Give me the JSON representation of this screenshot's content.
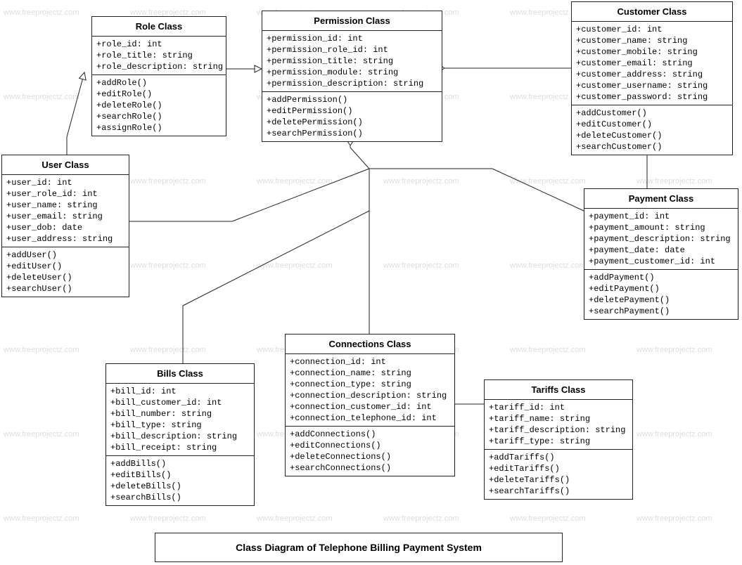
{
  "watermark_text": "www.freeprojectz.com",
  "title": "Class Diagram of Telephone Billing Payment System",
  "classes": {
    "role": {
      "name": "Role Class",
      "attrs": [
        "+role_id: int",
        "+role_title: string",
        "+role_description: string"
      ],
      "methods": [
        "+addRole()",
        "+editRole()",
        "+deleteRole()",
        "+searchRole()",
        "+assignRole()"
      ]
    },
    "permission": {
      "name": "Permission Class",
      "attrs": [
        "+permission_id: int",
        "+permission_role_id: int",
        "+permission_title: string",
        "+permission_module: string",
        "+permission_description: string"
      ],
      "methods": [
        "+addPermission()",
        "+editPermission()",
        "+deletePermission()",
        "+searchPermission()"
      ]
    },
    "customer": {
      "name": "Customer Class",
      "attrs": [
        "+customer_id: int",
        "+customer_name: string",
        "+customer_mobile: string",
        "+customer_email: string",
        "+customer_address: string",
        "+customer_username: string",
        "+customer_password: string"
      ],
      "methods": [
        "+addCustomer()",
        "+editCustomer()",
        "+deleteCustomer()",
        "+searchCustomer()"
      ]
    },
    "user": {
      "name": "User Class",
      "attrs": [
        "+user_id: int",
        "+user_role_id: int",
        "+user_name: string",
        "+user_email: string",
        "+user_dob: date",
        "+user_address: string"
      ],
      "methods": [
        "+addUser()",
        "+editUser()",
        "+deleteUser()",
        "+searchUser()"
      ]
    },
    "payment": {
      "name": "Payment Class",
      "attrs": [
        "+payment_id: int",
        "+payment_amount: string",
        "+payment_description: string",
        "+payment_date: date",
        "+payment_customer_id: int"
      ],
      "methods": [
        "+addPayment()",
        "+editPayment()",
        "+deletePayment()",
        "+searchPayment()"
      ]
    },
    "connections": {
      "name": "Connections Class",
      "attrs": [
        "+connection_id: int",
        "+connection_name: string",
        "+connection_type: string",
        "+connection_description: string",
        "+connection_customer_id: int",
        "+connection_telephone_id: int"
      ],
      "methods": [
        "+addConnections()",
        "+editConnections()",
        "+deleteConnections()",
        "+searchConnections()"
      ]
    },
    "bills": {
      "name": "Bills Class",
      "attrs": [
        "+bill_id: int",
        "+bill_customer_id: int",
        "+bill_number: string",
        "+bill_type: string",
        "+bill_description: string",
        "+bill_receipt: string"
      ],
      "methods": [
        "+addBills()",
        "+editBills()",
        "+deleteBills()",
        "+searchBills()"
      ]
    },
    "tariffs": {
      "name": "Tariffs Class",
      "attrs": [
        "+tariff_id: int",
        "+tariff_name: string",
        "+tariff_description: string",
        "+tariff_type: string"
      ],
      "methods": [
        "+addTariffs()",
        "+editTariffs()",
        "+deleteTariffs()",
        "+searchTariffs()"
      ]
    }
  }
}
